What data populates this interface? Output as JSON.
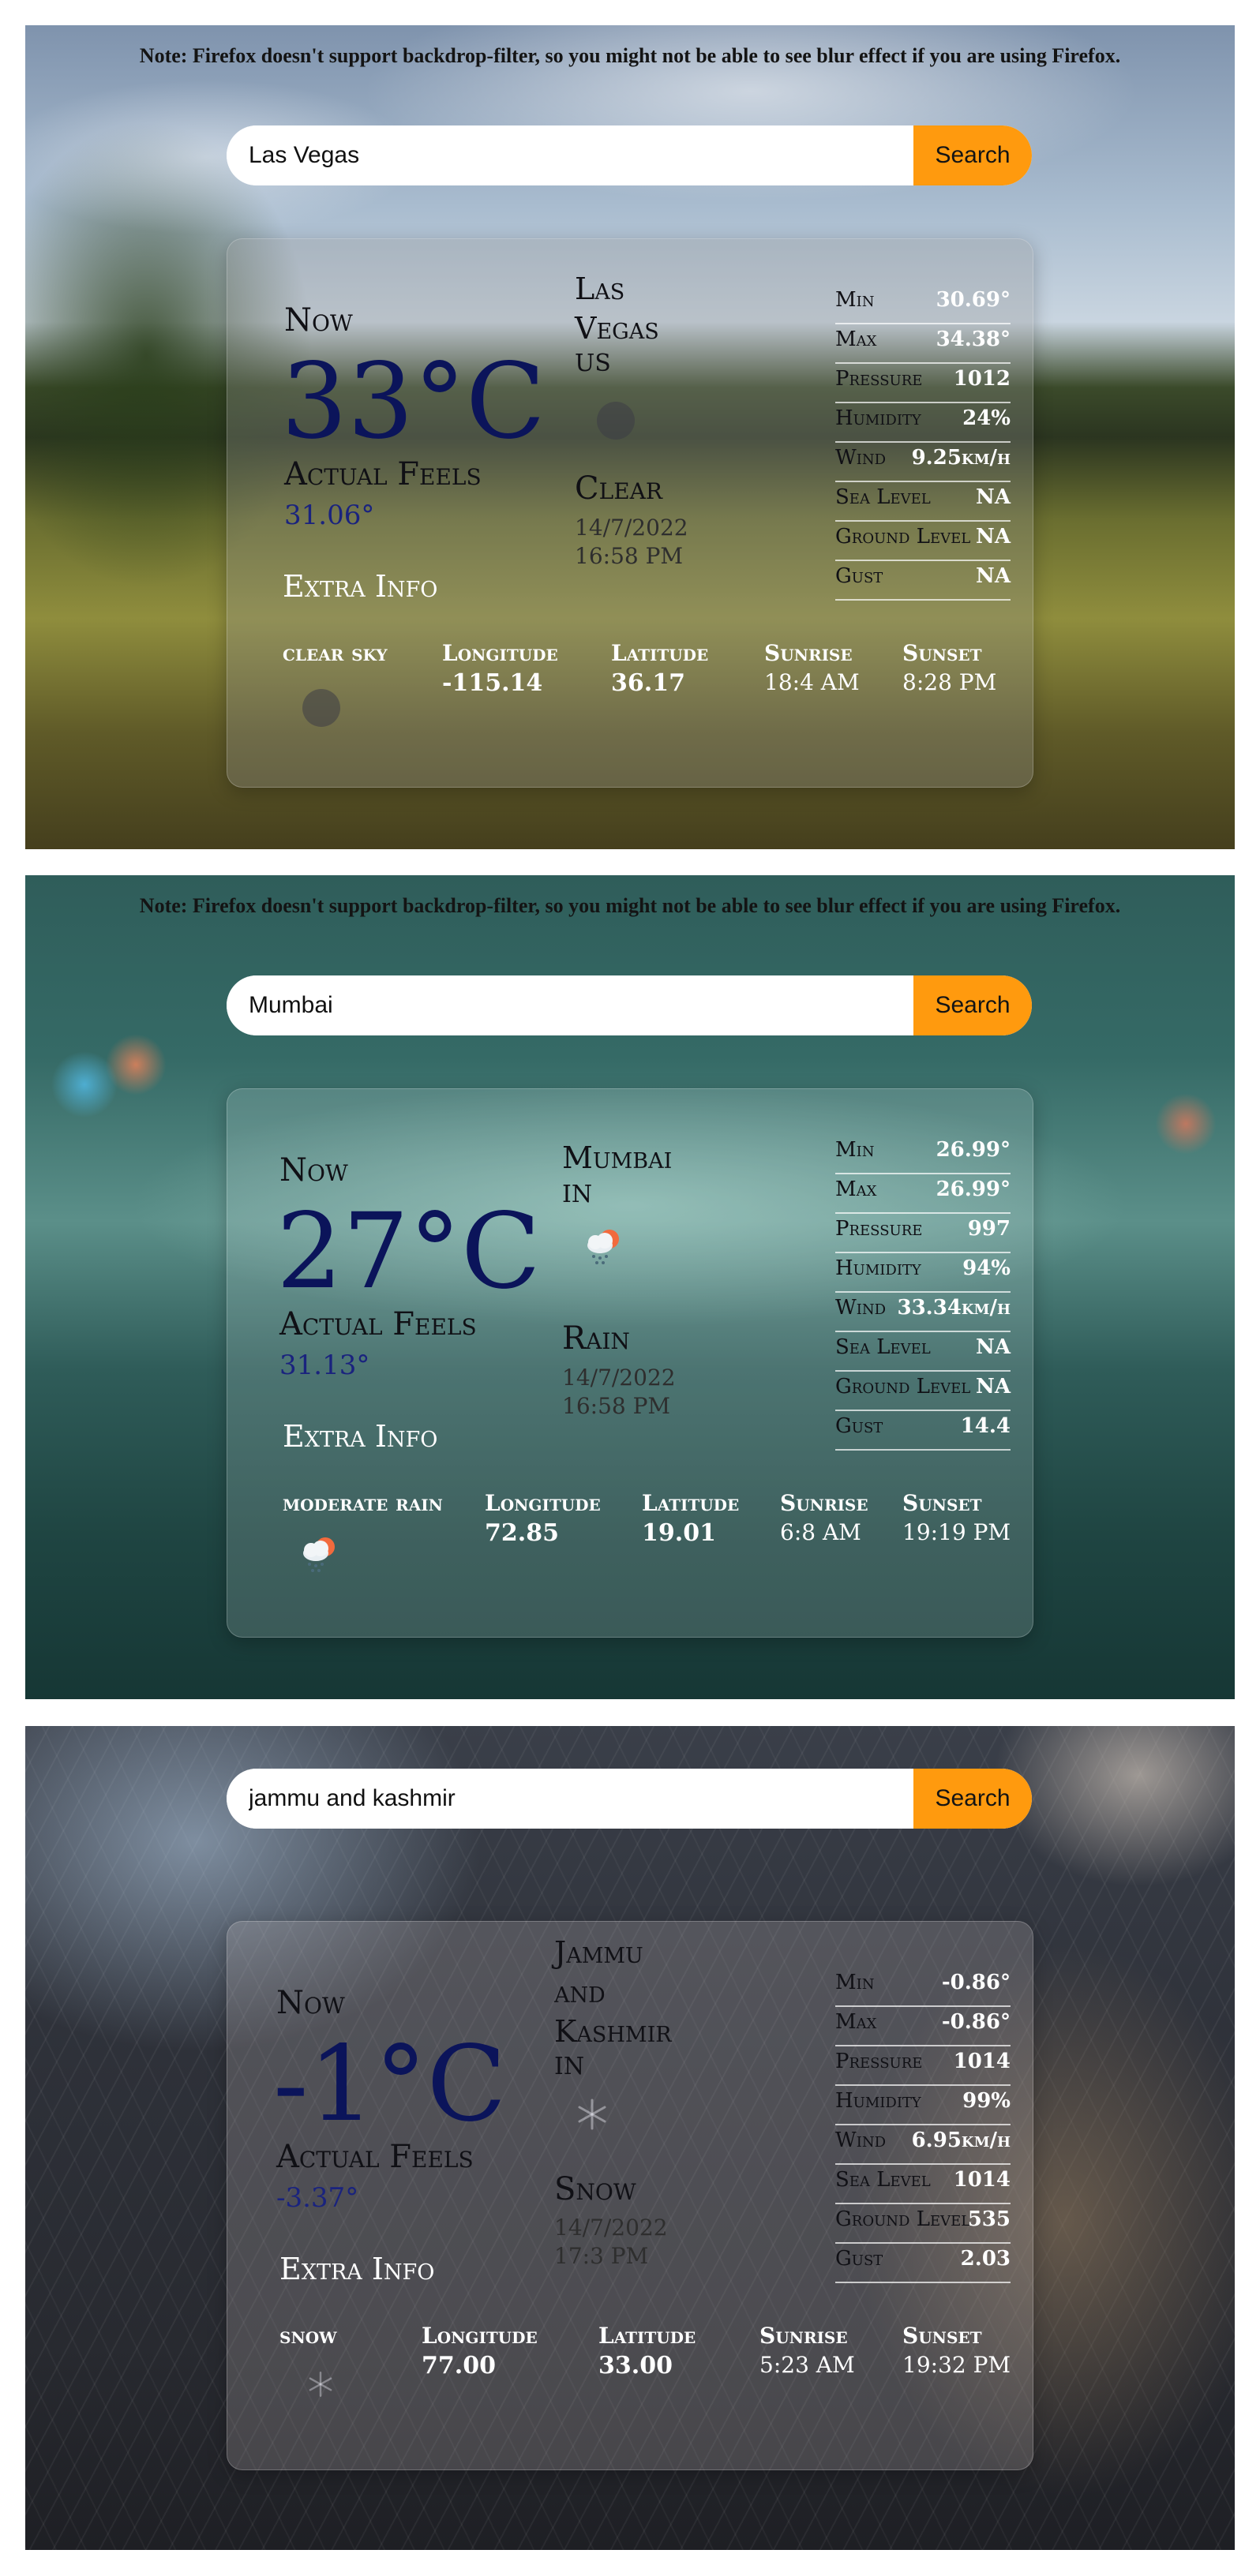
{
  "note": "Note: Firefox doesn't support backdrop-filter, so you might not be able to see blur effect if you are using Firefox.",
  "search_button_label": "Search",
  "accent_color": "#ff9a0e",
  "labels": {
    "now": "Now",
    "actual_feels": "Actual Feels",
    "extra_info": "Extra Info",
    "longitude": "Longitude",
    "latitude": "Latitude",
    "sunrise": "Sunrise",
    "sunset": "Sunset",
    "min": "Min",
    "max": "Max",
    "pressure": "Pressure",
    "humidity": "Humidity",
    "wind": "Wind",
    "sea_level": "Sea Level",
    "ground_level": "Ground Level",
    "gust": "Gust"
  },
  "panels": [
    {
      "search_value": "Las Vegas",
      "temperature": "33°C",
      "feels": "31.06°",
      "city": [
        "Las",
        "Vegas"
      ],
      "country": "US",
      "condition": "Clear",
      "date": "14/7/2022",
      "time": "16:58 PM",
      "description": "clear sky",
      "icon": "clear-sky-icon",
      "longitude": "-115.14",
      "latitude": "36.17",
      "sunrise": "18:4 AM",
      "sunset": "8:28 PM",
      "stats": {
        "min": "30.69°",
        "max": "34.38°",
        "pressure": "1012",
        "humidity": "24%",
        "wind": "9.25km/h",
        "sea_level": "NA",
        "ground_level": "NA",
        "gust": "NA"
      }
    },
    {
      "search_value": "Mumbai",
      "temperature": "27°C",
      "feels": "31.13°",
      "city": [
        "Mumbai"
      ],
      "country": "IN",
      "condition": "Rain",
      "date": "14/7/2022",
      "time": "16:58 PM",
      "description": "moderate rain",
      "icon": "rain-cloud-icon",
      "longitude": "72.85",
      "latitude": "19.01",
      "sunrise": "6:8 AM",
      "sunset": "19:19 PM",
      "stats": {
        "min": "26.99°",
        "max": "26.99°",
        "pressure": "997",
        "humidity": "94%",
        "wind": "33.34km/h",
        "sea_level": "NA",
        "ground_level": "NA",
        "gust": "14.4"
      }
    },
    {
      "search_value": "jammu and kashmir",
      "temperature": "-1°C",
      "feels": "-3.37°",
      "city": [
        "Jammu",
        "and",
        "Kashmir"
      ],
      "country": "IN",
      "condition": "Snow",
      "date": "14/7/2022",
      "time": "17:3 PM",
      "description": "snow",
      "icon": "snowflake-icon",
      "longitude": "77.00",
      "latitude": "33.00",
      "sunrise": "5:23 AM",
      "sunset": "19:32 PM",
      "stats": {
        "min": "-0.86°",
        "max": "-0.86°",
        "pressure": "1014",
        "humidity": "99%",
        "wind": "6.95km/h",
        "sea_level": "1014",
        "ground_level": "535",
        "gust": "2.03"
      }
    }
  ]
}
